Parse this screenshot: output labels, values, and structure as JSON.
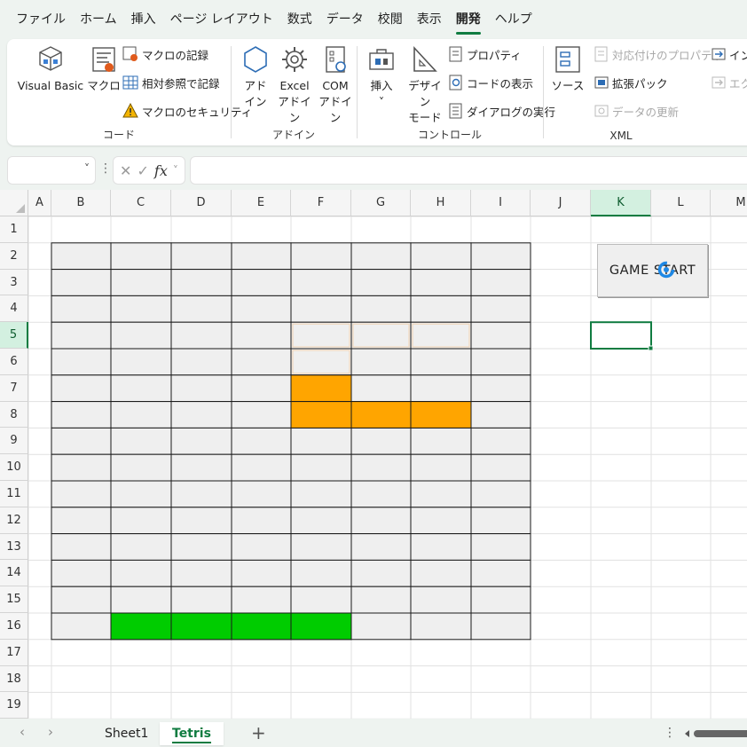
{
  "menu": [
    "ファイル",
    "ホーム",
    "挿入",
    "ページ レイアウト",
    "数式",
    "データ",
    "校閲",
    "表示",
    "開発",
    "ヘルプ"
  ],
  "menu_active": "開発",
  "ribbon": {
    "code": {
      "visual_basic": "Visual Basic",
      "macro": "マクロ",
      "record_macro": "マクロの記録",
      "relative_ref": "相対参照で記録",
      "macro_security": "マクロのセキュリティ",
      "label": "コード"
    },
    "addins": {
      "addin_l1": "アド",
      "addin_l2": "イン",
      "excel_l1": "Excel",
      "excel_l2": "アドイン",
      "com_l1": "COM",
      "com_l2": "アドイン",
      "label": "アドイン"
    },
    "controls": {
      "insert": "挿入",
      "insert_chevron": "˅",
      "design_l1": "デザイン",
      "design_l2": "モード",
      "properties": "プロパティ",
      "view_code": "コードの表示",
      "run_dialog": "ダイアログの実行",
      "label": "コントロール"
    },
    "xml": {
      "source": "ソース",
      "map_props": "対応付けのプロパティ",
      "expansion": "拡張パック",
      "refresh": "データの更新",
      "import": "インポ",
      "export": "エクス",
      "label": "XML"
    }
  },
  "formula_bar": {
    "name_box": "",
    "chevron": "˅",
    "dots": "⋮",
    "cancel": "✕",
    "enter": "✓",
    "fx": "fx",
    "fx_chevron": "˅",
    "formula": ""
  },
  "sheet": {
    "columns": [
      "A",
      "B",
      "C",
      "D",
      "E",
      "F",
      "G",
      "H",
      "I",
      "J",
      "K",
      "L",
      "M"
    ],
    "rows": [
      "1",
      "2",
      "3",
      "4",
      "5",
      "6",
      "7",
      "8",
      "9",
      "10",
      "11",
      "12",
      "13",
      "14",
      "15",
      "16",
      "17",
      "18",
      "19"
    ],
    "selected_cell": "K5",
    "board_range": "B2:I16",
    "board_fill": "#efefef",
    "falling_piece_color": "#ffa500",
    "falling_piece_cells": [
      "F7",
      "F8",
      "G8",
      "H8"
    ],
    "landed_color": "#00cc00",
    "landed_cells": [
      "C16",
      "D16",
      "E16",
      "F16"
    ],
    "ghost_color": "#f3c89a",
    "ghost_cells": [
      "F5",
      "F6",
      "G5",
      "H5"
    ]
  },
  "button": {
    "label": "GAME START"
  },
  "tabs": {
    "prev": "‹",
    "next": "›",
    "sheets": [
      "Sheet1",
      "Tetris"
    ],
    "active": "Tetris",
    "add": "+",
    "dots": "⋮"
  }
}
